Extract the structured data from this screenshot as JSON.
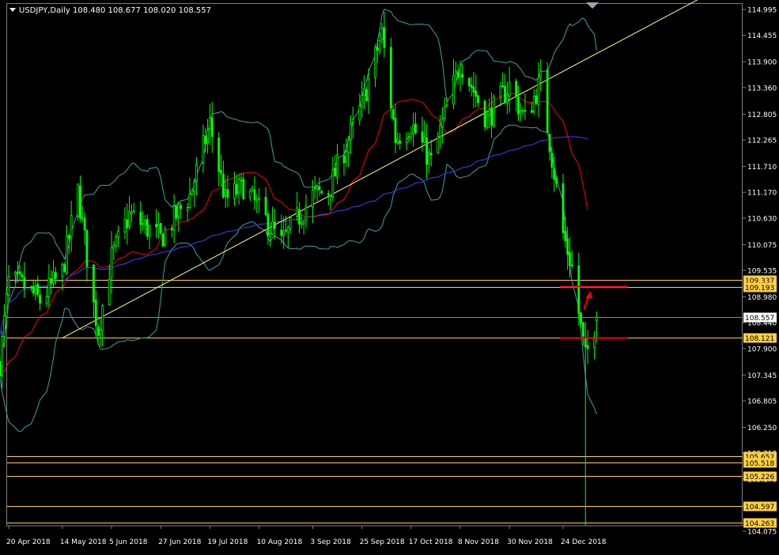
{
  "header": {
    "symbol_label": "USDJPY,Daily",
    "ohlc_label": "108.480 108.677 108.020 108.557"
  },
  "colors": {
    "background": "#000000",
    "bull_candle": "#00ff00",
    "bear_candle": "#ffffff",
    "ma_fast": "#ff0000",
    "ma_slow": "#4040ff",
    "bands": "#40a0a0",
    "trendline": "#ffff80",
    "level_line": "#ffd040",
    "level_tag_bg": "#ffd040",
    "current_price_line": "#7a8a9a",
    "current_price_tag_bg": "#ffffff",
    "annotation": "#ff0000",
    "axis_text": "#ffffff",
    "frame": "#7f7f7f"
  },
  "chart_data": {
    "type": "candlestick",
    "instrument": "USDJPY",
    "timeframe": "Daily",
    "ylim": [
      103.8,
      115.15
    ],
    "y_ticks": [
      114.995,
      114.455,
      113.9,
      113.36,
      112.805,
      112.265,
      111.71,
      111.17,
      110.63,
      110.075,
      109.535,
      108.98,
      108.44,
      107.9,
      107.345,
      106.805,
      106.25,
      105.71,
      105.17,
      104.615,
      104.075
    ],
    "x_labels": [
      "20 Apr 2018",
      "14 May 2018",
      "5 Jun 2018",
      "27 Jun 2018",
      "19 Jul 2018",
      "10 Aug 2018",
      "3 Sep 2018",
      "25 Sep 2018",
      "17 Oct 2018",
      "8 Nov 2018",
      "30 Nov 2018",
      "24 Dec 2018"
    ],
    "last_ohlc": {
      "open": 108.48,
      "high": 108.677,
      "low": 108.02,
      "close": 108.557
    },
    "current_price": 108.557,
    "horizontal_levels": [
      109.337,
      109.193,
      108.121,
      105.652,
      105.518,
      105.226,
      104.597,
      104.263
    ],
    "trendline": {
      "from": [
        "14 May 2018",
        108.12
      ],
      "to": [
        "24 Dec 2018",
        113.7
      ],
      "extended": true
    },
    "annotations": [
      {
        "type": "segment",
        "date_start": "24 Dec 2018",
        "date_end": "8 Jan 2019",
        "price": 109.193
      },
      {
        "type": "segment",
        "date_start": "24 Dec 2018",
        "date_end": "8 Jan 2019",
        "price": 108.121
      },
      {
        "type": "arrow",
        "direction": "up",
        "date": "2 Jan 2019",
        "from_price": 108.72,
        "to_price": 109.1
      }
    ],
    "price_path": [
      {
        "date": "16 Apr 2018",
        "price": 107.6
      },
      {
        "date": "20 Apr 2018",
        "price": 109.3
      },
      {
        "date": "27 Apr 2018",
        "price": 109.2
      },
      {
        "date": "4 May 2018",
        "price": 108.9
      },
      {
        "date": "14 May 2018",
        "price": 109.5
      },
      {
        "date": "21 May 2018",
        "price": 111.2
      },
      {
        "date": "28 May 2018",
        "price": 108.8
      },
      {
        "date": "30 May 2018",
        "price": 108.3
      },
      {
        "date": "5 Jun 2018",
        "price": 109.8
      },
      {
        "date": "13 Jun 2018",
        "price": 110.7
      },
      {
        "date": "27 Jun 2018",
        "price": 110.2
      },
      {
        "date": "10 Jul 2018",
        "price": 111.1
      },
      {
        "date": "19 Jul 2018",
        "price": 112.6
      },
      {
        "date": "26 Jul 2018",
        "price": 111.0
      },
      {
        "date": "3 Aug 2018",
        "price": 111.3
      },
      {
        "date": "10 Aug 2018",
        "price": 110.8
      },
      {
        "date": "20 Aug 2018",
        "price": 110.1
      },
      {
        "date": "3 Sep 2018",
        "price": 111.1
      },
      {
        "date": "10 Sep 2018",
        "price": 111.2
      },
      {
        "date": "25 Sep 2018",
        "price": 113.0
      },
      {
        "date": "4 Oct 2018",
        "price": 114.5
      },
      {
        "date": "10 Oct 2018",
        "price": 112.3
      },
      {
        "date": "17 Oct 2018",
        "price": 112.6
      },
      {
        "date": "26 Oct 2018",
        "price": 111.8
      },
      {
        "date": "8 Nov 2018",
        "price": 113.9
      },
      {
        "date": "20 Nov 2018",
        "price": 112.7
      },
      {
        "date": "30 Nov 2018",
        "price": 113.4
      },
      {
        "date": "7 Dec 2018",
        "price": 112.7
      },
      {
        "date": "14 Dec 2018",
        "price": 113.5
      },
      {
        "date": "24 Dec 2018",
        "price": 110.3
      },
      {
        "date": "28 Dec 2018",
        "price": 109.6
      },
      {
        "date": "3 Jan 2019",
        "price": 107.7
      },
      {
        "date": "8 Jan 2019",
        "price": 108.557
      }
    ],
    "flash_crash": {
      "date": "3 Jan 2019",
      "low": 104.2
    }
  }
}
